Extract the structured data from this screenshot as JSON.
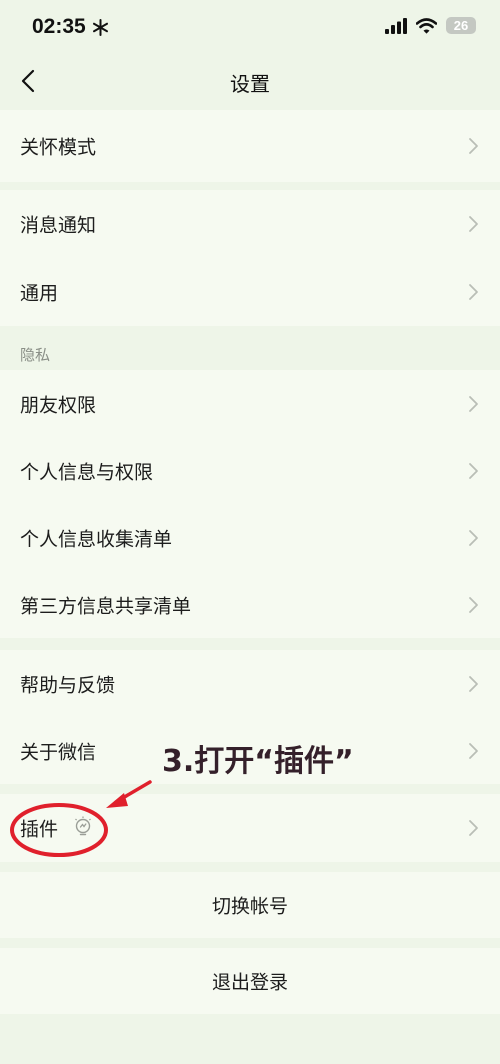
{
  "status_bar": {
    "time": "02:35",
    "battery": "26"
  },
  "nav": {
    "title": "设置"
  },
  "rows": {
    "care_mode": "关怀模式",
    "notifications": "消息通知",
    "general": "通用",
    "privacy_header": "隐私",
    "friend_permissions": "朋友权限",
    "personal_info_permissions": "个人信息与权限",
    "personal_info_collection": "个人信息收集清单",
    "third_party_sharing": "第三方信息共享清单",
    "help_feedback": "帮助与反馈",
    "about_wechat": "关于微信",
    "plugins": "插件",
    "switch_account": "切换帐号",
    "log_out": "退出登录"
  },
  "annotation": {
    "text": "3.打开“插件”",
    "color": "#e0202c"
  },
  "colors": {
    "background": "#eef5e8",
    "row_background": "#f6faf1",
    "text": "#1d1d1d",
    "chevron": "#b9beb6"
  }
}
